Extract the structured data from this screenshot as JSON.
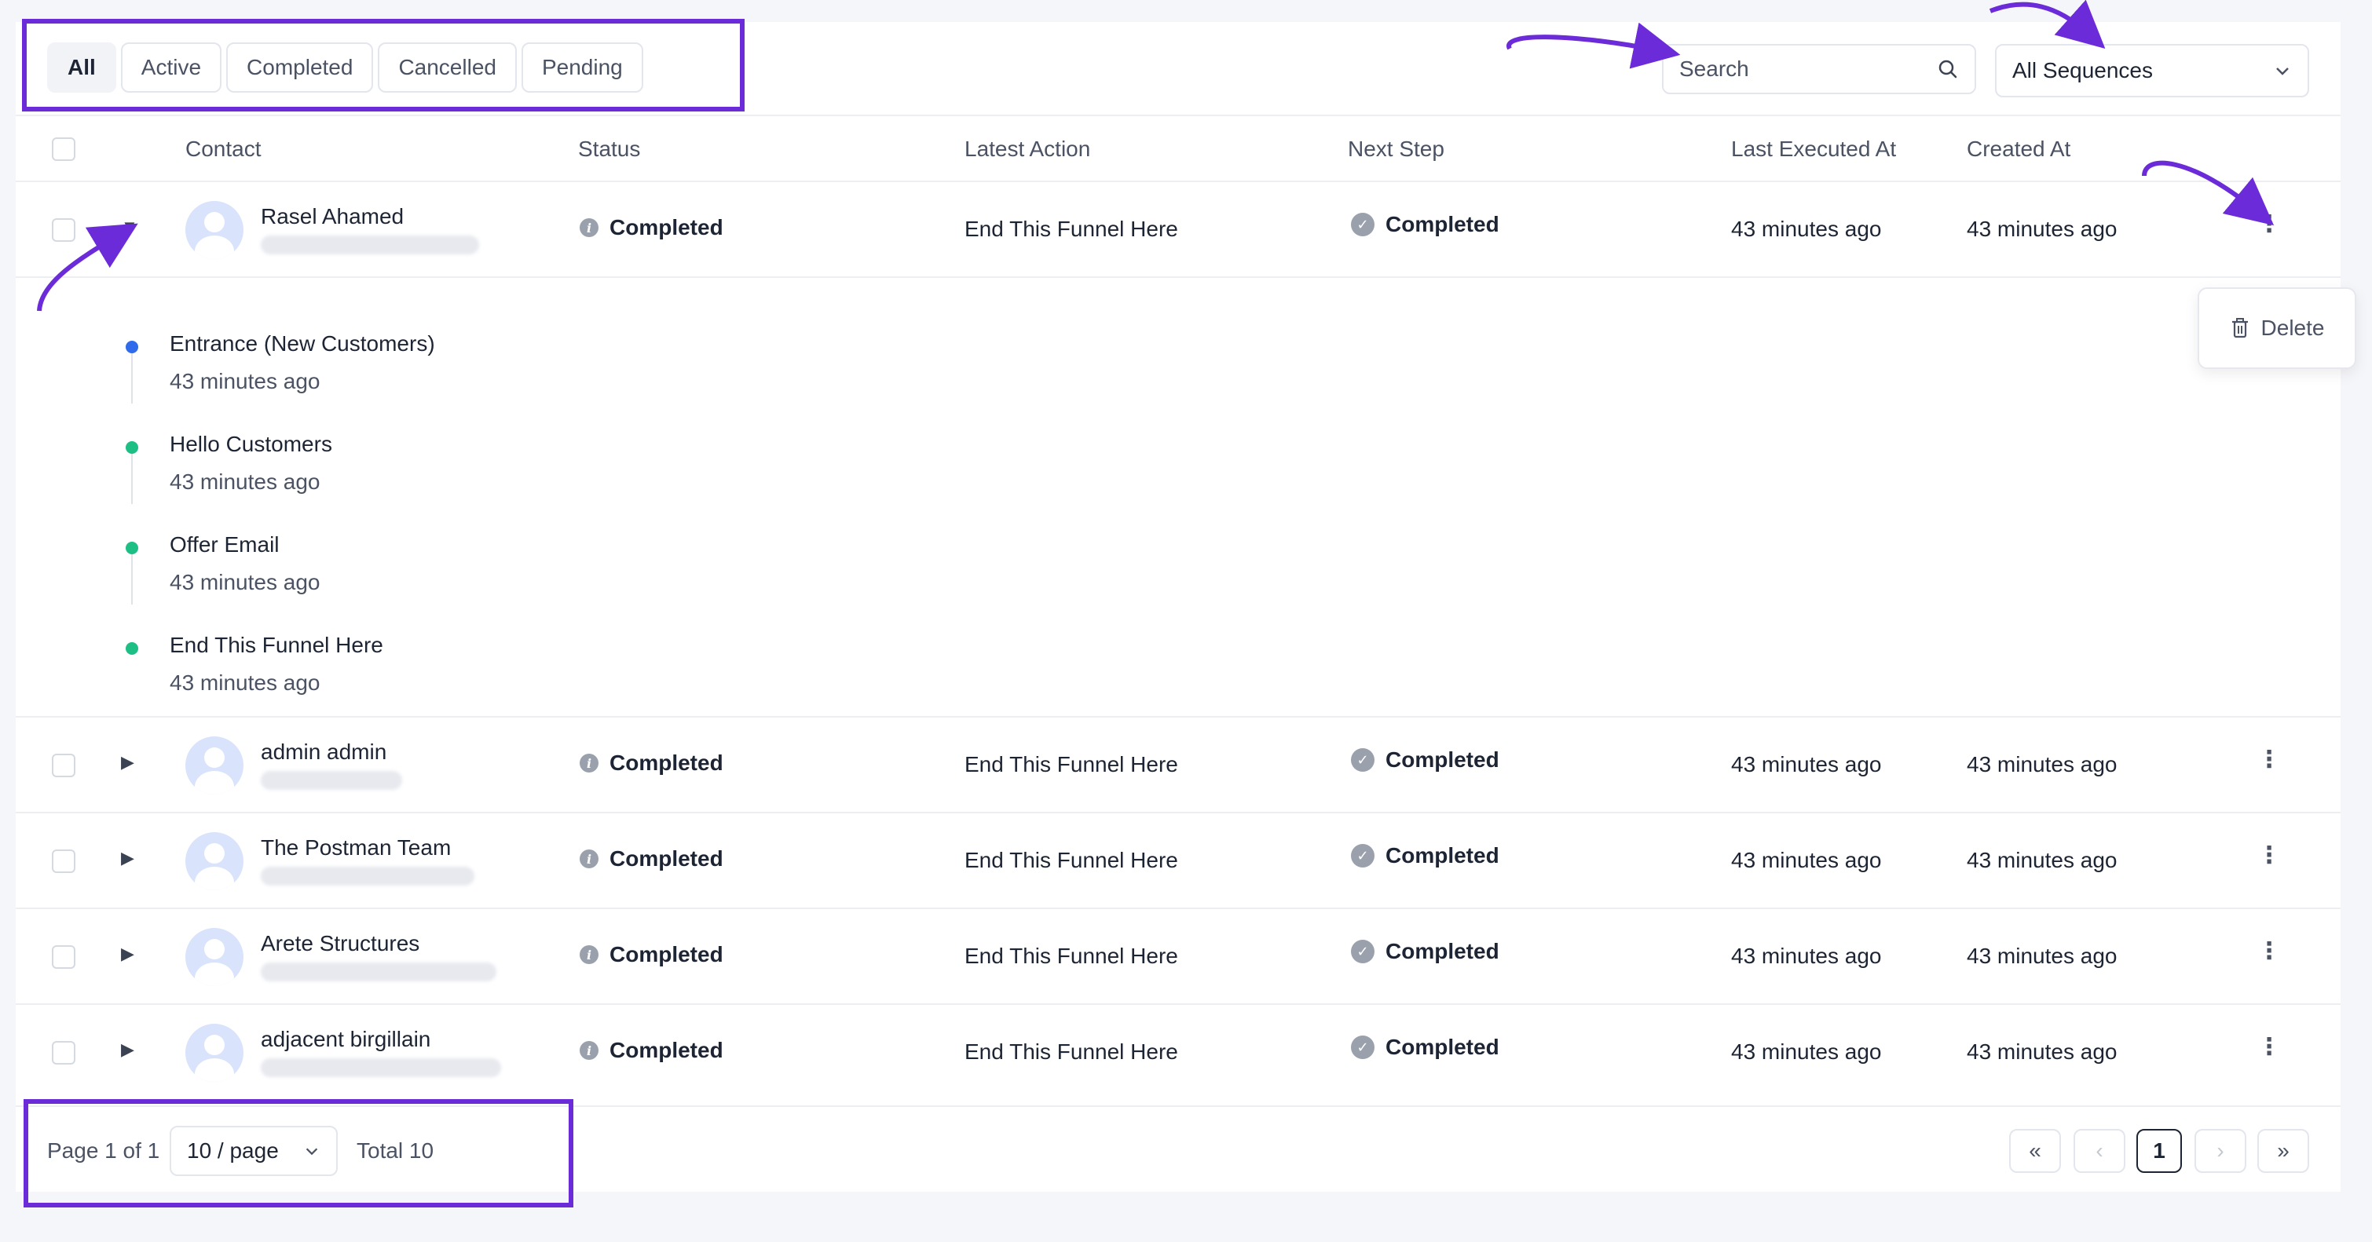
{
  "filters": {
    "tabs": [
      {
        "label": "All",
        "active": true
      },
      {
        "label": "Active",
        "active": false
      },
      {
        "label": "Completed",
        "active": false
      },
      {
        "label": "Cancelled",
        "active": false
      },
      {
        "label": "Pending",
        "active": false
      }
    ]
  },
  "search": {
    "placeholder": "Search",
    "icon": "search-icon"
  },
  "sequence_select": {
    "value": "All Sequences",
    "icon": "chevron-down-icon"
  },
  "table": {
    "headers": {
      "contact": "Contact",
      "status": "Status",
      "latest_action": "Latest Action",
      "next_step": "Next Step",
      "last_executed_at": "Last Executed At",
      "created_at": "Created At"
    },
    "rows": [
      {
        "name": "Rasel Ahamed",
        "status": "Completed",
        "latest_action": "End This Funnel Here",
        "next_step": "Completed",
        "last_executed_at": "43 minutes ago",
        "created_at": "43 minutes ago",
        "toggle": "▼",
        "expanded": true
      },
      {
        "name": "admin admin",
        "status": "Completed",
        "latest_action": "End This Funnel Here",
        "next_step": "Completed",
        "last_executed_at": "43 minutes ago",
        "created_at": "43 minutes ago",
        "toggle": "▶",
        "expanded": false
      },
      {
        "name": "The Postman Team",
        "status": "Completed",
        "latest_action": "End This Funnel Here",
        "next_step": "Completed",
        "last_executed_at": "43 minutes ago",
        "created_at": "43 minutes ago",
        "toggle": "▶",
        "expanded": false
      },
      {
        "name": "Arete Structures",
        "status": "Completed",
        "latest_action": "End This Funnel Here",
        "next_step": "Completed",
        "last_executed_at": "43 minutes ago",
        "created_at": "43 minutes ago",
        "toggle": "▶",
        "expanded": false
      },
      {
        "name": "adjacent birgillain",
        "status": "Completed",
        "latest_action": "End This Funnel Here",
        "next_step": "Completed",
        "last_executed_at": "43 minutes ago",
        "created_at": "43 minutes ago",
        "toggle": "▶",
        "expanded": false
      }
    ]
  },
  "timeline": {
    "steps": [
      {
        "title": "Entrance (New Customers)",
        "time": "43 minutes ago",
        "color": "#2f6bea"
      },
      {
        "title": "Hello Customers",
        "time": "43 minutes ago",
        "color": "#1dbf85"
      },
      {
        "title": "Offer Email",
        "time": "43 minutes ago",
        "color": "#1dbf85"
      },
      {
        "title": "End This Funnel Here",
        "time": "43 minutes ago",
        "color": "#1dbf85"
      }
    ]
  },
  "row_menu": {
    "delete_label": "Delete",
    "icon": "trash-icon"
  },
  "pagination": {
    "page_text": "Page 1 of 1",
    "page_size": "10 / page",
    "total_text": "Total 10",
    "current_page": "1",
    "first_label": "«",
    "prev_label": "‹",
    "next_label": "›",
    "last_label": "»"
  },
  "colors": {
    "annotation": "#6c2bd9",
    "info_icon": "#9aa1ac",
    "timeline_first": "#2f6bea",
    "timeline_rest": "#1dbf85"
  }
}
